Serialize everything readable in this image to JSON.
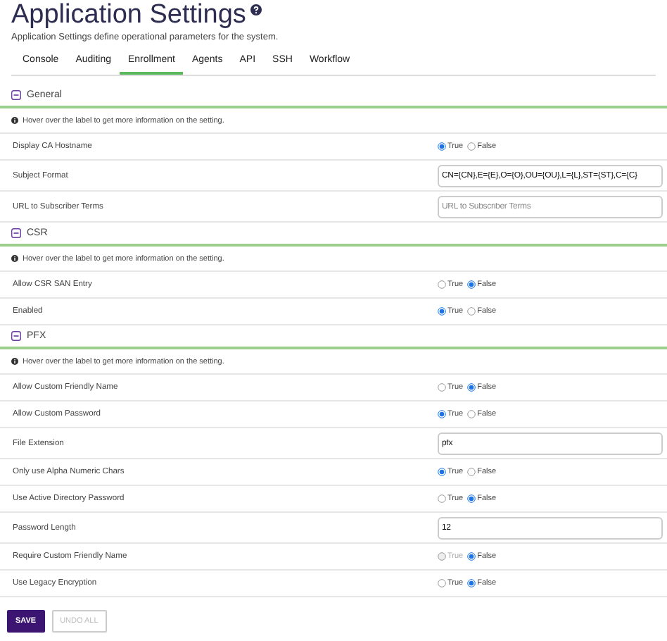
{
  "page": {
    "title": "Application Settings",
    "subtitle": "Application Settings define operational parameters for the system."
  },
  "tabs": [
    {
      "label": "Console",
      "selected": false
    },
    {
      "label": "Auditing",
      "selected": false
    },
    {
      "label": "Enrollment",
      "selected": true
    },
    {
      "label": "Agents",
      "selected": false
    },
    {
      "label": "API",
      "selected": false
    },
    {
      "label": "SSH",
      "selected": false
    },
    {
      "label": "Workflow",
      "selected": false
    }
  ],
  "sections": [
    {
      "title": "General",
      "expanded": true,
      "info": "Hover over the label to get more information on the setting.",
      "settings": [
        {
          "kind": "radio",
          "label": "Display CA Hostname",
          "options": [
            {
              "label": "True",
              "selected": true,
              "disabled": false
            },
            {
              "label": "False",
              "selected": false,
              "disabled": false
            }
          ]
        },
        {
          "kind": "text",
          "label": "Subject Format",
          "value": "CN={CN},E={E},O={O},OU={OU},L={L},ST={ST},C={C}"
        },
        {
          "kind": "text",
          "label": "URL to Subscriber Terms",
          "placeholder": "URL to Subscriber Terms"
        }
      ]
    },
    {
      "title": "CSR",
      "expanded": true,
      "info": "Hover over the label to get more information on the setting.",
      "settings": [
        {
          "kind": "radio",
          "label": "Allow CSR SAN Entry",
          "options": [
            {
              "label": "True",
              "selected": false,
              "disabled": false
            },
            {
              "label": "False",
              "selected": true,
              "disabled": false
            }
          ]
        },
        {
          "kind": "radio",
          "label": "Enabled",
          "options": [
            {
              "label": "True",
              "selected": true,
              "disabled": false
            },
            {
              "label": "False",
              "selected": false,
              "disabled": false
            }
          ]
        }
      ]
    },
    {
      "title": "PFX",
      "expanded": true,
      "info": "Hover over the label to get more information on the setting.",
      "settings": [
        {
          "kind": "radio",
          "label": "Allow Custom Friendly Name",
          "options": [
            {
              "label": "True",
              "selected": false,
              "disabled": false
            },
            {
              "label": "False",
              "selected": true,
              "disabled": false
            }
          ]
        },
        {
          "kind": "radio",
          "label": "Allow Custom Password",
          "options": [
            {
              "label": "True",
              "selected": true,
              "disabled": false
            },
            {
              "label": "False",
              "selected": false,
              "disabled": false
            }
          ]
        },
        {
          "kind": "text",
          "label": "File Extension",
          "value": "pfx"
        },
        {
          "kind": "radio",
          "label": "Only use Alpha Numeric Chars",
          "options": [
            {
              "label": "True",
              "selected": true,
              "disabled": false
            },
            {
              "label": "False",
              "selected": false,
              "disabled": false
            }
          ]
        },
        {
          "kind": "radio",
          "label": "Use Active Directory Password",
          "options": [
            {
              "label": "True",
              "selected": false,
              "disabled": false
            },
            {
              "label": "False",
              "selected": true,
              "disabled": false
            }
          ]
        },
        {
          "kind": "text",
          "label": "Password Length",
          "value": "12"
        },
        {
          "kind": "radio",
          "label": "Require Custom Friendly Name",
          "options": [
            {
              "label": "True",
              "selected": false,
              "disabled": true
            },
            {
              "label": "False",
              "selected": true,
              "disabled": false
            }
          ]
        },
        {
          "kind": "radio",
          "label": "Use Legacy Encryption",
          "options": [
            {
              "label": "True",
              "selected": false,
              "disabled": false
            },
            {
              "label": "False",
              "selected": true,
              "disabled": false
            }
          ]
        }
      ]
    }
  ],
  "buttons": [
    {
      "label": "SAVE",
      "disabled": false
    },
    {
      "label": "UNDO ALL",
      "disabled": true
    }
  ]
}
